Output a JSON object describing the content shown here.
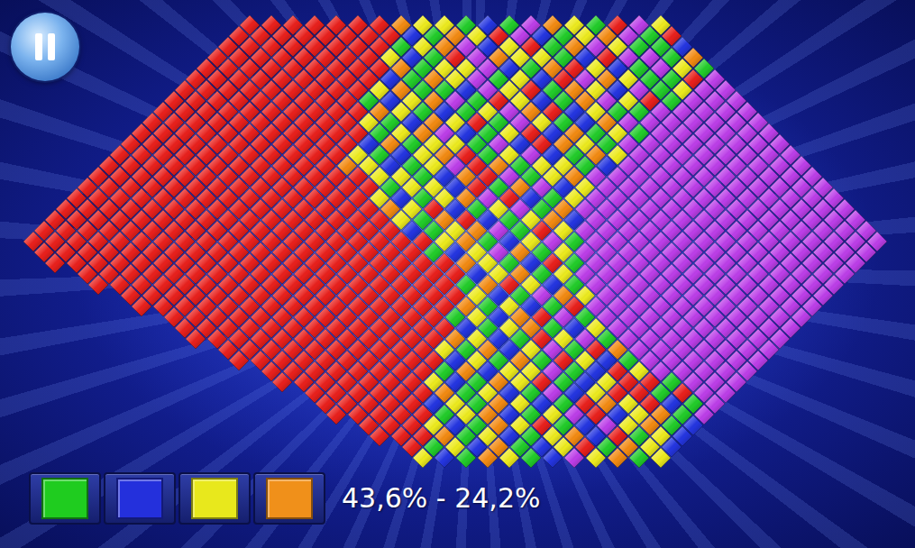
{
  "board": {
    "palette": {
      "r": "#e8201c",
      "p": "#bc3ee8",
      "g": "#22cc2a",
      "b": "#2435e0",
      "y": "#ecea1e",
      "o": "#f28a12"
    },
    "rows": [
      "rrrrrrroyygbgpoygrpy",
      "rrrrrrrrbgoyrpbgyopgr",
      "rrrrrrrrgyopbyrgopyggb",
      "rrrrrrrrybgrpoyygbrppgo",
      "rrrrrrrrrogyypbgorybgpyg",
      "rrrrrrrrrbgoypgybrpoyggrp",
      "rrrrrrrrryoggbpyrgoybpgypp",
      "rrrrrrrrrgbyopgrybgopyrgppp",
      "rrrrrrrrrroygbgyporbyggppppp",
      "rrrrrrrrrrygboyrgpygboppppppp",
      "rrrrrrrrrrrgyopbgyrbogygpppppp",
      "rrrrrrrrrrrbogyygpbroygpppppppp",
      "rrrrrrrrrrrygbyorgypbgoypppppppp",
      "rrrrrrrrrrroybgyprogyygbppppppppp",
      "rrrrrrrrrrrrryygborpgyoppppppppppp",
      "rrrrrrrrrrrrrrgyybrgopbyppppppppppp",
      "rrrrrrrrrrrrrrybgyoprbgypppppppppppp",
      "rrrrrrrrrrrrrrroyrbgypgoppppppppppppp",
      "rrrrrrrrrrrrrrrrygorbgyobppppppppppppp",
      "rrrrrrrrrrrrrrrrrbgyopgrypppppppppppppp",
      "rrrrrrrrrrrrrrrrrrryogbypgpppppppppppppp",
      "rrrrrrrrrrrrrrrrrrgbypogypppppppppppppp",
      "rrrrrrrrrrrrrrrrrrroygbrgppppppppppppp",
      "rrrrrrrrrrrrrrrrrrbyogyppppppppppppp",
      "rrrrrrrrrrrrrrrrrgorybgpppppppppppp",
      "rrrrrrrrrrrrrrrrybgpoyppppppppppp",
      "rrrrrrrrrrrrrrrogybgrppppppppppp",
      "rrrrrrrrrrrrrgyborpgpppppppppp",
      "rrrrrrrrrrrrrbgyogbyppppppppp",
      "rrrrrrrrrrrroybgrypgpppppppp",
      "rrrrrrrrrrygobypgroppppppp",
      "rrrrrrrrrrbygogrybgpppppp",
      "rrrrrrrrgobyypgbryppppp",
      "rrrrrrrybgoyrgbyrrgppp",
      "rrrrrrogybgpbyrrgrpp",
      "rrrrrbygoybgroyrbgp",
      "rrrrrgyobgyprbyogp",
      "rrrybgoyrgbpyogb",
      "rrrogybgyobrgyb",
      "rgybogbyrgoyb",
      "ybgoygbpyogy"
    ]
  },
  "color_buttons": [
    {
      "color": "#1fcc1f"
    },
    {
      "color": "#2430dc"
    },
    {
      "color": "#e8e81c"
    },
    {
      "color": "#f0901a"
    }
  ],
  "score": "43,6% - 24,2%"
}
